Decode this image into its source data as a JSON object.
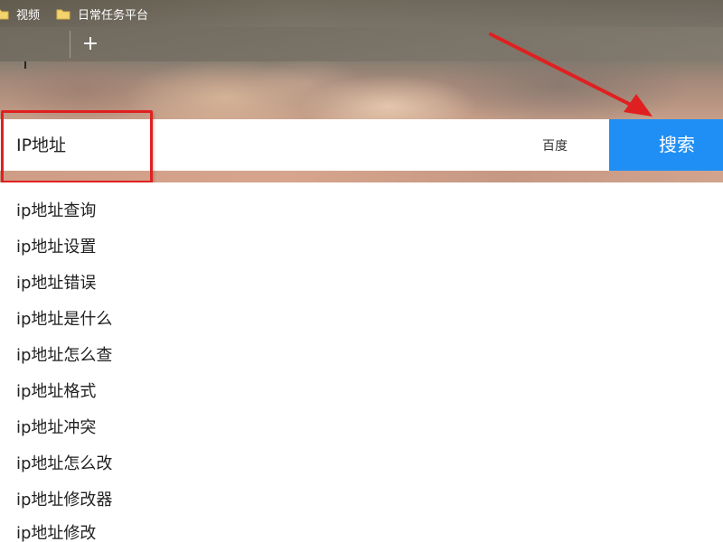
{
  "bookmarks": [
    {
      "label": "视频",
      "icon": "folder-icon"
    },
    {
      "label": "日常任务平台",
      "icon": "folder-icon"
    }
  ],
  "tab_strip": {
    "new_tab_icon": "plus-icon",
    "new_tab_glyph": "+"
  },
  "search": {
    "query": "IP地址",
    "engine": "百度",
    "engine_icon": "chevron-down-icon",
    "button_label": "搜索",
    "button_color": "#1f8ff5"
  },
  "annotation": {
    "highlight_color": "#e02020",
    "arrow_color": "#e02020"
  },
  "suggestions": [
    "ip地址查询",
    "ip地址设置",
    "ip地址错误",
    "ip地址是什么",
    "ip地址怎么查",
    "ip地址格式",
    "ip地址冲突",
    "ip地址怎么改",
    "ip地址修改器",
    "ip地址修改"
  ]
}
